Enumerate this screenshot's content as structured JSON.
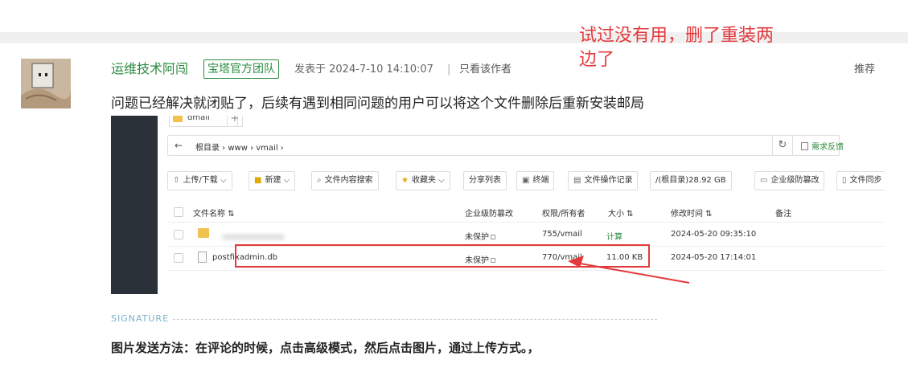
{
  "annotation": {
    "line1": "试过没有用，删了重装两",
    "line2": "边了"
  },
  "post": {
    "author": "运维技术阿闯",
    "badge": "宝塔官方团队",
    "posted_at": "发表于 2024-7-10 14:10:07",
    "separator": "|",
    "author_only": "只看该作者",
    "recommend": "推荐",
    "message": "问题已经解决就闭贴了，后续有遇到相同问题的用户可以将这个文件删除后重新安装邮局"
  },
  "screenshot": {
    "tab_label": "dmail",
    "tab_plus": "+",
    "back_icon": "←",
    "breadcrumb": "根目录  ›  www  ›  vmail  ›",
    "refresh_icon": "↻",
    "feedback": "需求反馈",
    "toolbar": {
      "upload": "上传/下载 ⌵",
      "new": "新建 ⌵",
      "search": "文件内容搜索",
      "favorites": "收藏夹 ⌵",
      "share": "分享列表",
      "terminal": "终端",
      "oplog": "文件操作记录",
      "disk": "/(根目录)28.92 GB",
      "tamper": "企业级防篡改",
      "sync": "文件同步"
    },
    "columns": {
      "name": "文件名称 ⇅",
      "tamper": "企业级防篡改",
      "perm": "权限/所有者",
      "size": "大小 ⇅",
      "mtime": "修改时间 ⇅",
      "note": "备注"
    },
    "rows": [
      {
        "name": "",
        "tamper": "未保护",
        "perm": "755/vmail",
        "size": "计算",
        "mtime": "2024-05-20 09:35:10"
      },
      {
        "name": "postfixadmin.db",
        "tamper": "未保护",
        "perm": "770/vmail",
        "size": "11.00 KB",
        "mtime": "2024-05-20 17:14:01"
      }
    ]
  },
  "signature": {
    "label": "SIGNATURE",
    "text": "图片发送方法：在评论的时候，点击高级模式，然后点击图片，通过上传方式。，"
  },
  "colors": {
    "accent_green": "#2b8a3e",
    "annotation_red": "#e4393c"
  }
}
